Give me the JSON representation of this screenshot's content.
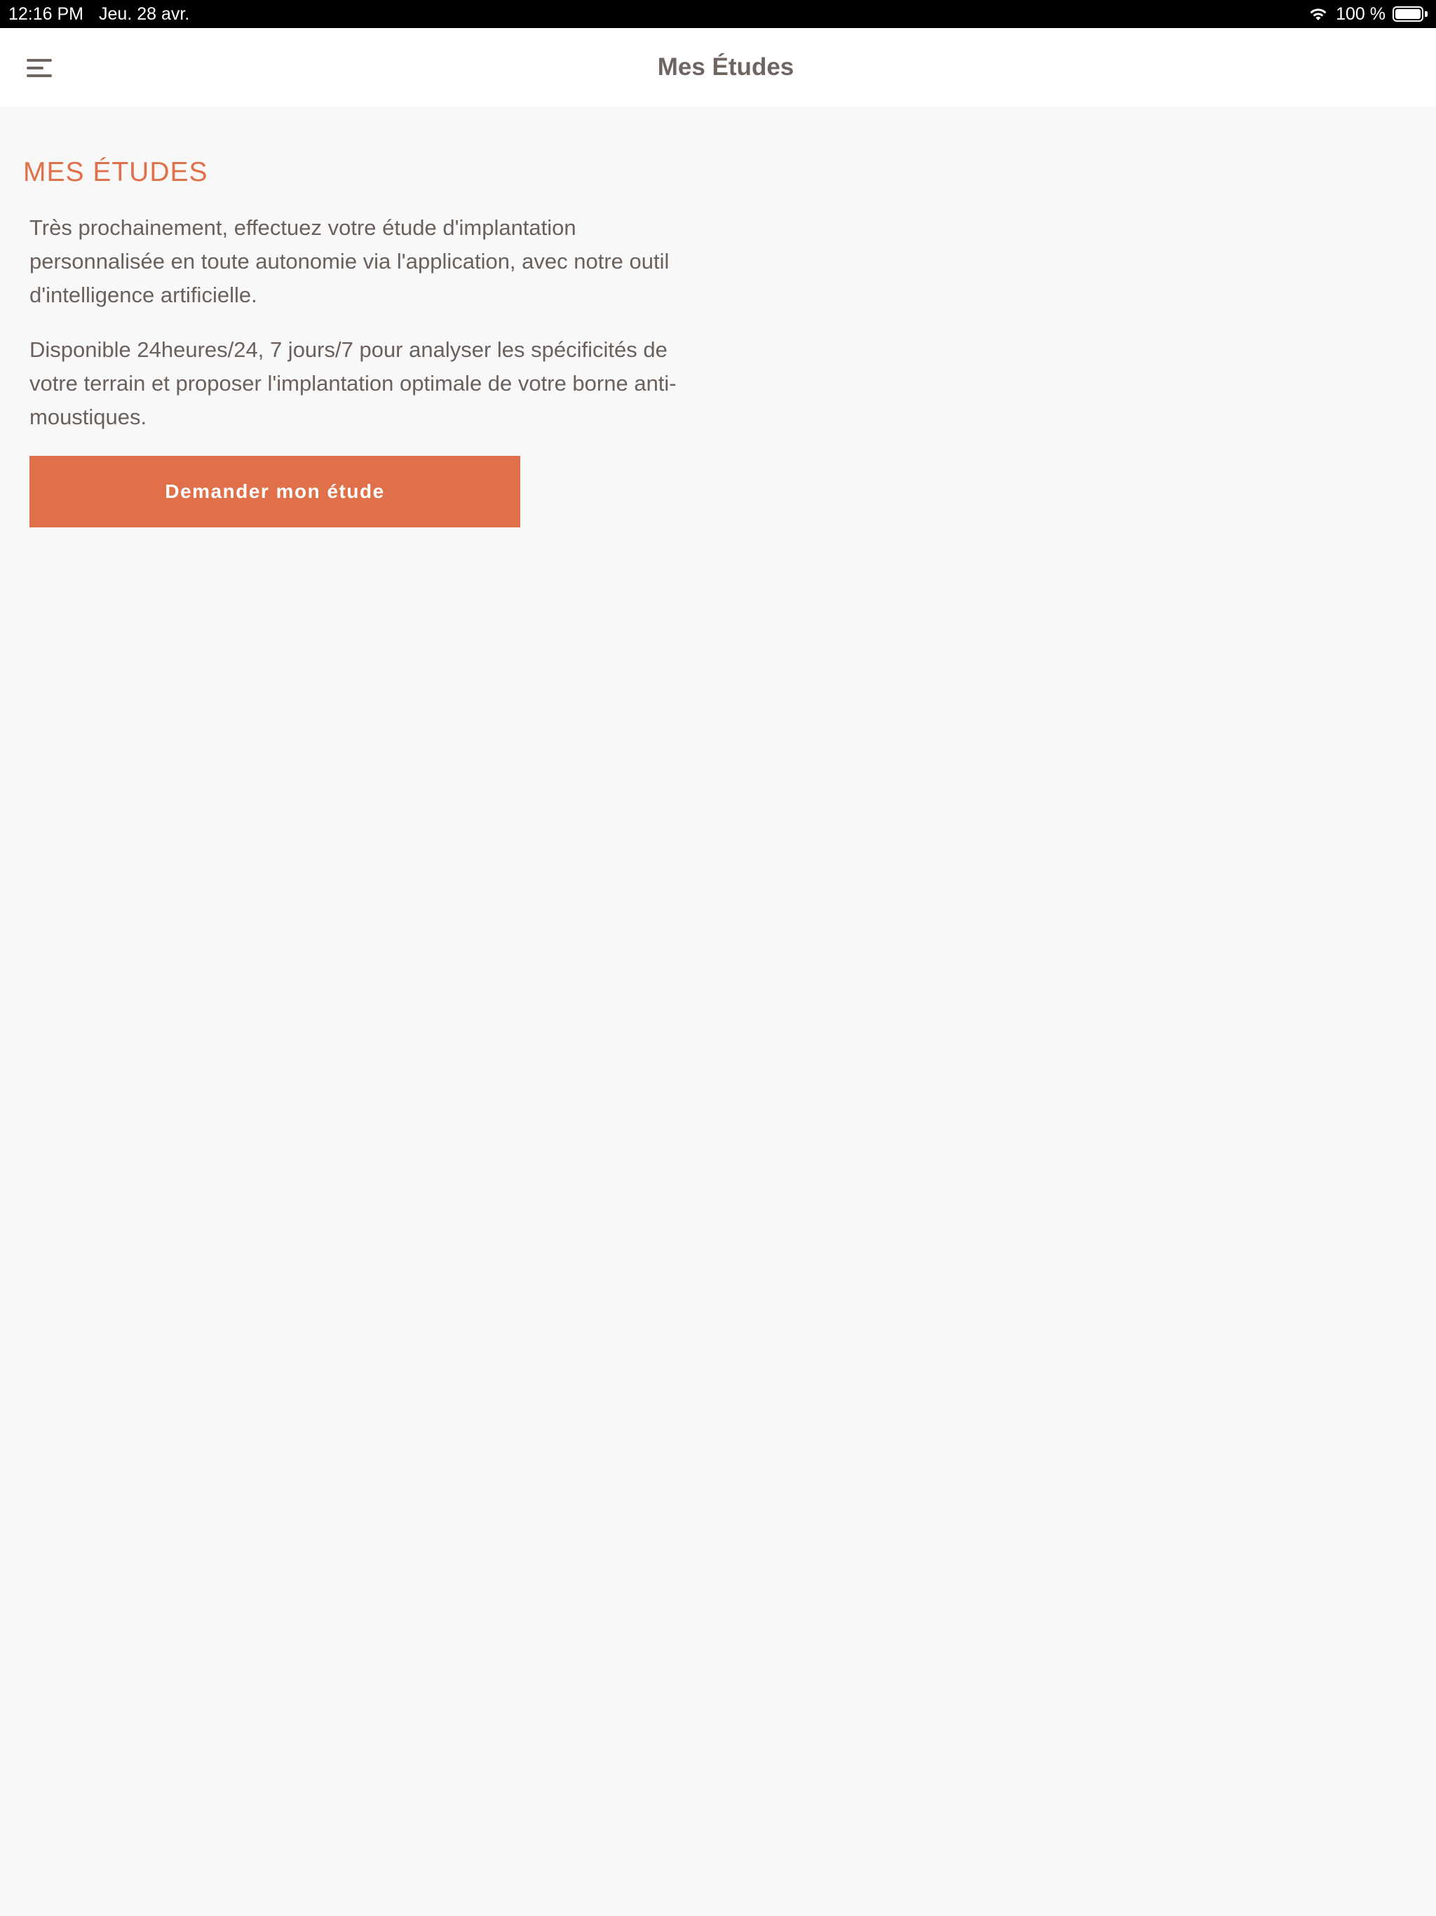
{
  "status_bar": {
    "time": "12:16 PM",
    "date": "Jeu. 28 avr.",
    "battery": "100 %"
  },
  "nav": {
    "title": "Mes Études",
    "menu_icon": "hamburger-icon"
  },
  "main": {
    "section_title": "MES ÉTUDES",
    "paragraphs": [
      "Très prochainement, effectuez votre étude d'implantation personnalisée en toute autonomie via l'application, avec notre outil d'intelligence artificielle.",
      "Disponible 24heures/24, 7 jours/7 pour analyser les spécificités de votre terrain et proposer l'implantation optimale de votre borne anti-moustiques."
    ],
    "cta_label": "Demander mon étude"
  },
  "colors": {
    "accent": "#e07049",
    "text": "#6a605c",
    "background": "#f8f8f8",
    "nav_background": "#ffffff"
  }
}
